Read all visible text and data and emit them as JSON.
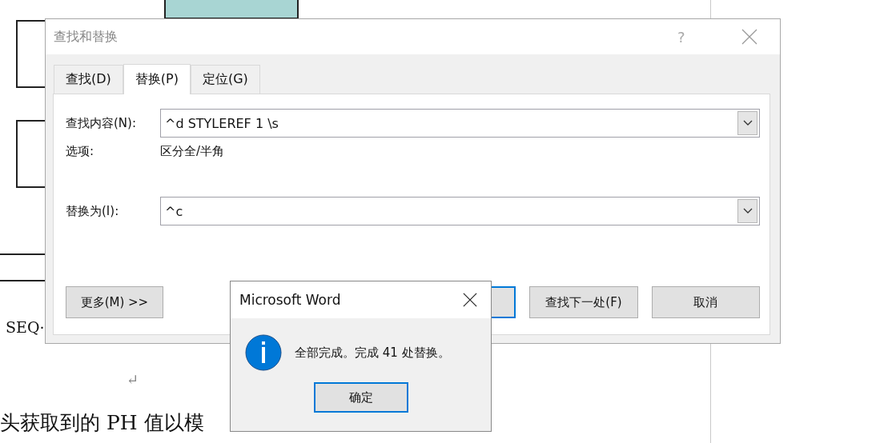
{
  "document": {
    "field_code": "SEQ·",
    "paragraph_mark": "↵",
    "body_text": "头获取到的 PH 值以模"
  },
  "dialog": {
    "title": "查找和替换",
    "help": "?",
    "tabs": [
      {
        "label": "查找(D)",
        "selected": false
      },
      {
        "label": "替换(P)",
        "selected": true
      },
      {
        "label": "定位(G)",
        "selected": false
      }
    ],
    "find": {
      "label": "查找内容(N):",
      "value": "^d STYLEREF 1 \\s"
    },
    "options": {
      "label": "选项:",
      "value": "区分全/半角"
    },
    "replace": {
      "label": "替换为(I):",
      "value": "^c"
    },
    "buttons": [
      {
        "label": "更多(M) >>",
        "kind": "more"
      },
      {
        "kind": "hidden-default"
      },
      {
        "label": "查找下一处(F)",
        "kind": "normal"
      },
      {
        "label": "取消",
        "kind": "normal"
      }
    ]
  },
  "message_box": {
    "title": "Microsoft Word",
    "message": "全部完成。完成 41 处替换。",
    "button": "确定"
  }
}
